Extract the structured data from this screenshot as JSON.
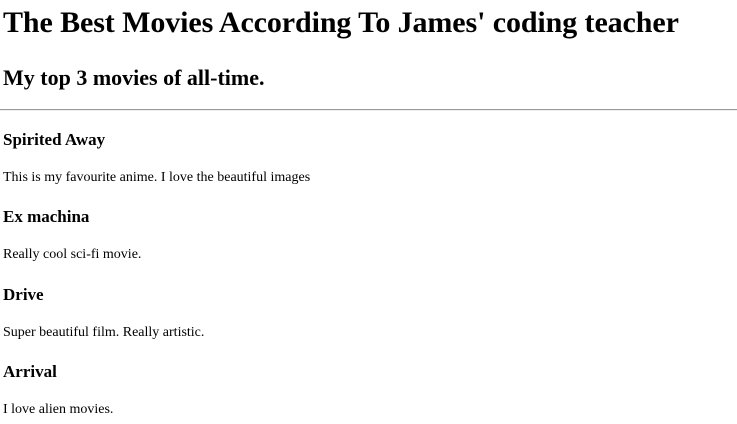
{
  "header": {
    "title": "The Best Movies According To James' coding teacher",
    "subtitle": "My top 3 movies of all-time."
  },
  "movies": [
    {
      "title": "Spirited Away",
      "description": "This is my favourite anime. I love the beautiful images"
    },
    {
      "title": "Ex machina",
      "description": "Really cool sci-fi movie."
    },
    {
      "title": "Drive",
      "description": "Super beautiful film. Really artistic."
    },
    {
      "title": "Arrival",
      "description": "I love alien movies."
    }
  ]
}
